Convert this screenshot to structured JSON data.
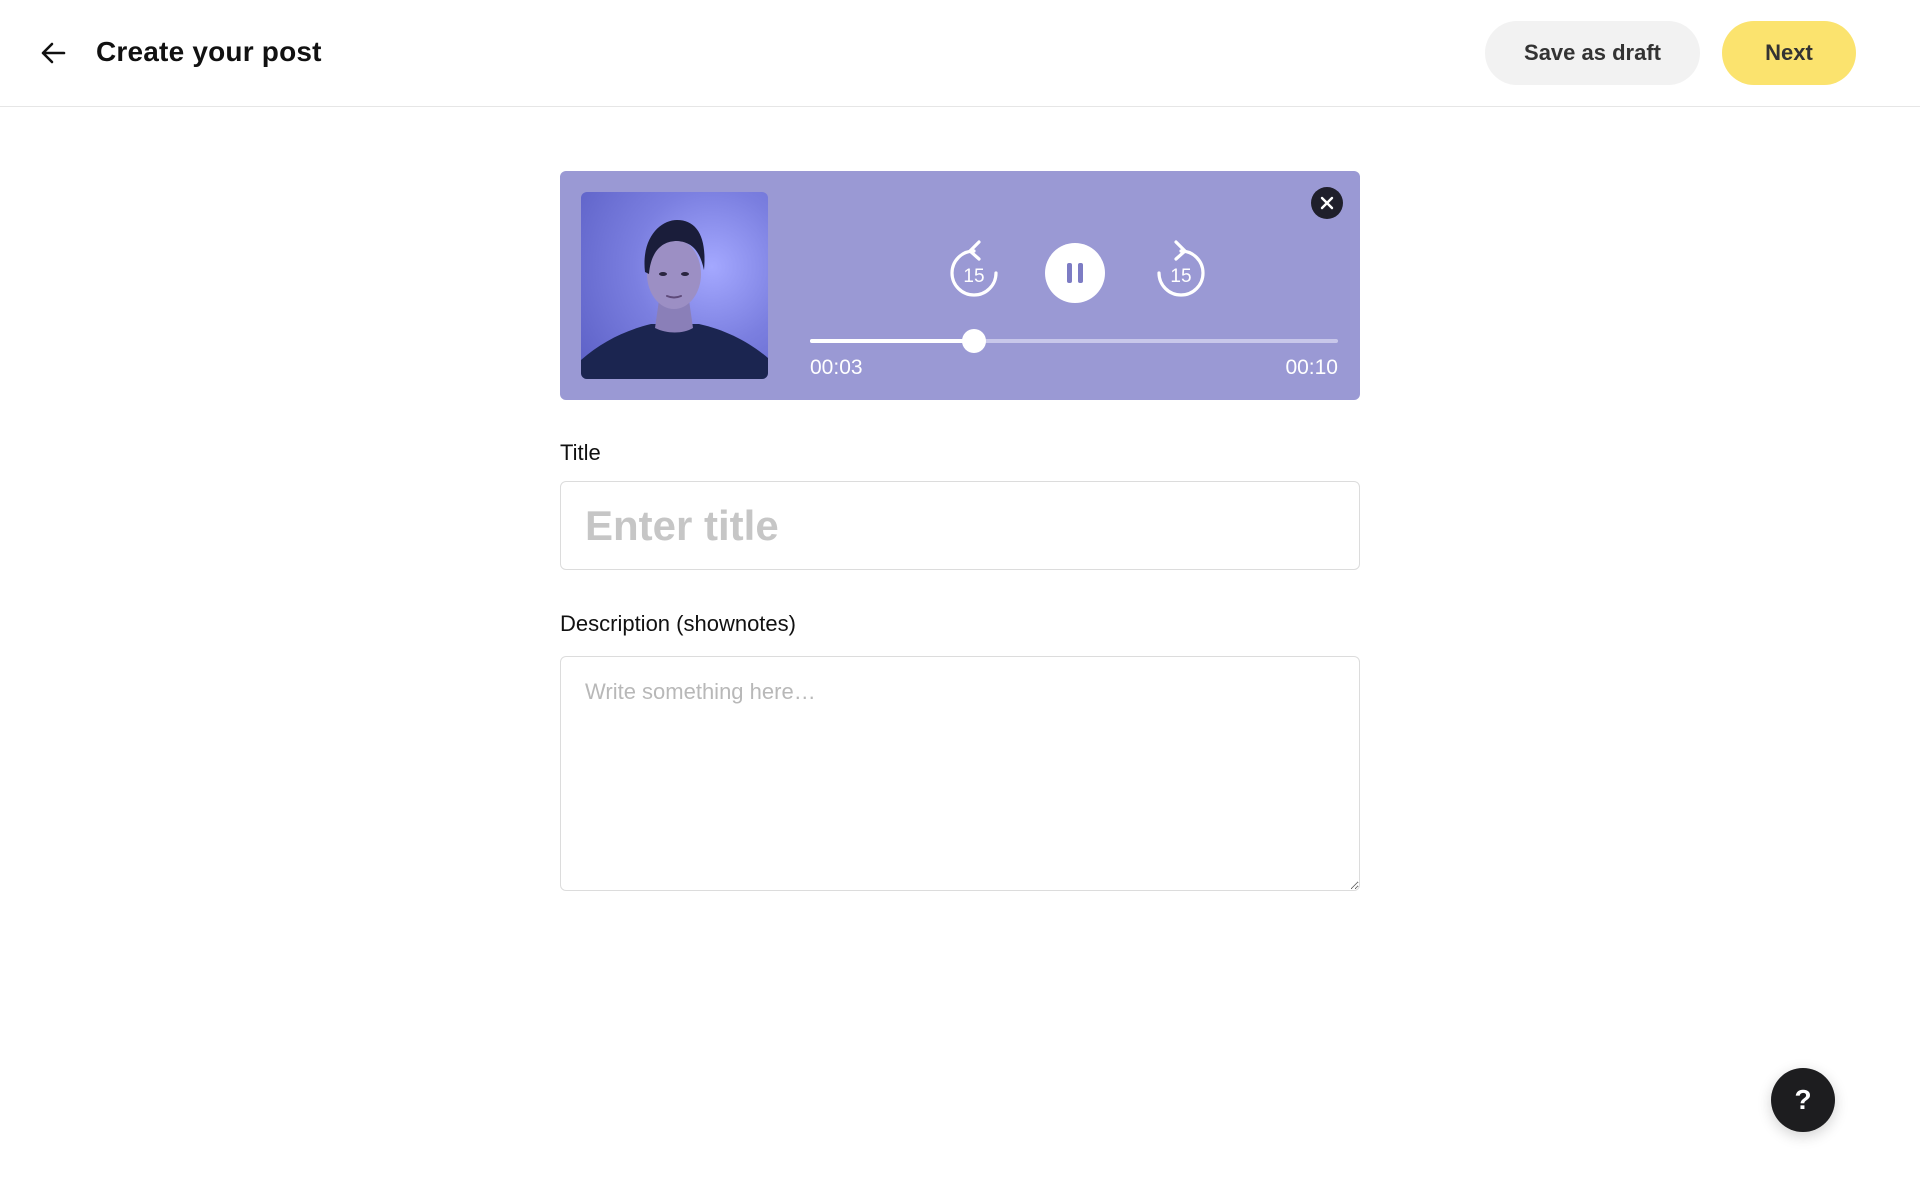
{
  "header": {
    "back_icon": "arrow-left-icon",
    "title": "Create your post",
    "save_draft_label": "Save as draft",
    "next_label": "Next"
  },
  "player": {
    "close_icon": "close-icon",
    "rewind_icon": "rewind-15-icon",
    "rewind_seconds": "15",
    "pause_icon": "pause-icon",
    "forward_icon": "forward-15-icon",
    "forward_seconds": "15",
    "current_time": "00:03",
    "total_time": "00:10",
    "progress": 0.31
  },
  "form": {
    "title_label": "Title",
    "title_placeholder": "Enter title",
    "title_value": "",
    "description_label": "Description (shownotes)",
    "description_placeholder": "Write something here…",
    "description_value": ""
  },
  "help": {
    "icon": "help-icon",
    "label": "?"
  },
  "colors": {
    "player_bg": "#9a99d4",
    "next_button": "#fbe36e",
    "draft_button": "#f2f2f2",
    "help_button": "#1d1d1f"
  }
}
